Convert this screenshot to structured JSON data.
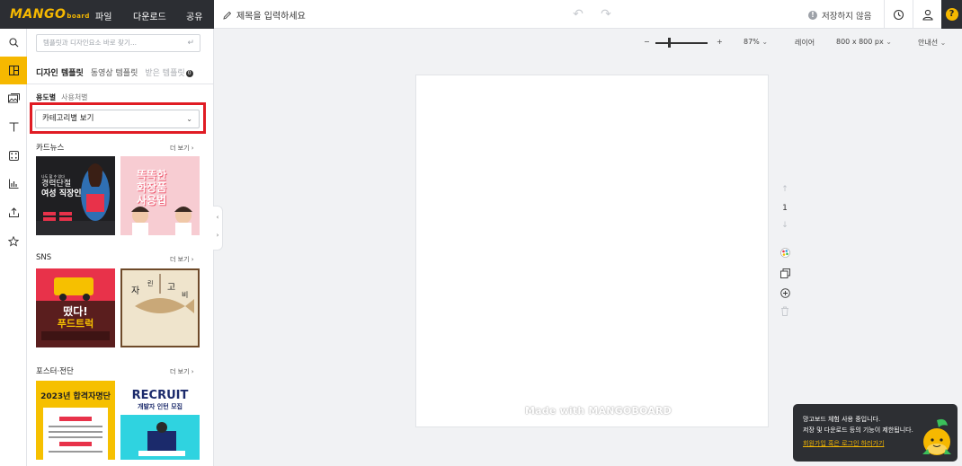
{
  "topbar": {
    "logo_text": "MANGO",
    "logo_sub": "board",
    "menu": [
      "파일",
      "다운로드",
      "공유"
    ],
    "title_placeholder": "제목을 입력하세요",
    "save_status": "저장하지 않음",
    "save_status_icon": "!",
    "help_label": "?"
  },
  "panel": {
    "search_placeholder": "템플릿과 디자인요소 바로 찾기...",
    "tabs": [
      {
        "label": "디자인 템플릿",
        "active": true
      },
      {
        "label": "동영상 템플릿",
        "active": false
      },
      {
        "label": "받은 템플릿",
        "active": false,
        "badge": "0"
      }
    ],
    "sub_tabs": [
      "용도별",
      "사용처별"
    ],
    "select_value": "카테고리별 보기",
    "more_label": "더 보기",
    "sections": [
      {
        "title": "카드뉴스",
        "thumbs": [
          {
            "lines": [
              "나도 할 수 있다",
              "경력단절",
              "여성 직장인"
            ],
            "bg": "#222222",
            "accent": "#e8324a"
          },
          {
            "lines": [
              "똑똑한",
              "화장품",
              "사용법"
            ],
            "bg": "#f6c5cd",
            "accent": "#ee5a70"
          }
        ]
      },
      {
        "title": "SNS",
        "thumbs": [
          {
            "lines": [
              "떴다!",
              "푸드트럭"
            ],
            "bg": "#5e2020",
            "accent": "#f6c000"
          },
          {
            "lines": [
              "자",
              "린",
              "고",
              "비"
            ],
            "bg": "#efe4cc",
            "accent": "#6e4a2a"
          }
        ]
      },
      {
        "title": "포스터·전단",
        "thumbs": [
          {
            "lines": [
              "2023년 합격자명단"
            ],
            "bg": "#f6c000",
            "accent": "#e8324a"
          },
          {
            "lines": [
              "RECRUIT",
              "개발자 인턴 모집"
            ],
            "bg": "#2fd3e0",
            "accent": "#1b2a6b"
          }
        ]
      }
    ]
  },
  "canvas": {
    "zoom_minus": "−",
    "zoom_plus": "+",
    "zoom_percent": "87%",
    "layers_label": "레이어",
    "size_label": "800 x 800 px",
    "guide_label": "안내선",
    "page_number": "1",
    "watermark": "Made with MANGOBOARD"
  },
  "toast": {
    "line1": "망고보드 체험 사용 중입니다.",
    "line2": "저장 및 다운로드 등의 기능이 제한됩니다.",
    "link": "회원가입 혹은 로그인 하러가기"
  },
  "colors": {
    "brand": "#f6b800",
    "dark": "#2c2e33",
    "highlight": "#e01c24"
  }
}
